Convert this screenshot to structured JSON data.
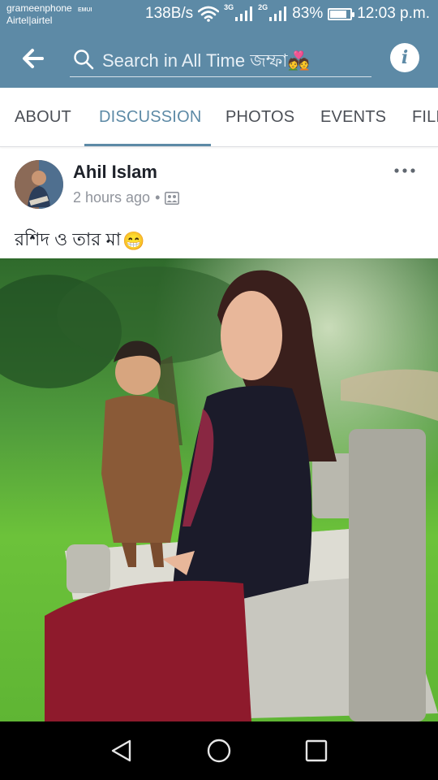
{
  "status_bar": {
    "carrier_1": "grameenphone",
    "carrier_2": "Airtel|airtel",
    "emui": "EMUI",
    "net_speed": "138B/s",
    "net_type_1": "3G",
    "net_type_2": "2G",
    "battery": "83%",
    "battery_level": 0.83,
    "time": "12:03 p.m."
  },
  "app_bar": {
    "search_text": "Search in All Time জম্ফা",
    "search_emoji": "💑",
    "info_label": "i",
    "icons": [
      "back-arrow-icon",
      "search-icon",
      "info-icon"
    ]
  },
  "tabs": [
    {
      "label": "ABOUT",
      "active": false
    },
    {
      "label": "DISCUSSION",
      "active": true
    },
    {
      "label": "PHOTOS",
      "active": false
    },
    {
      "label": "EVENTS",
      "active": false
    },
    {
      "label": "FILE",
      "active": false
    }
  ],
  "post": {
    "author": "Ahil Islam",
    "time": "2 hours ago",
    "separator": "•",
    "privacy_icon": "group-icon",
    "text": "রশিদ ও তার মা",
    "text_emoji": "😁"
  },
  "nav_bar": {
    "icons": [
      "back-triangle-icon",
      "home-circle-icon",
      "recents-square-icon"
    ]
  },
  "colors": {
    "brand": "#5d8aa6",
    "active_tab": "#5d8aa6",
    "tab_text": "#4b4f56",
    "meta_text": "#90949c"
  }
}
